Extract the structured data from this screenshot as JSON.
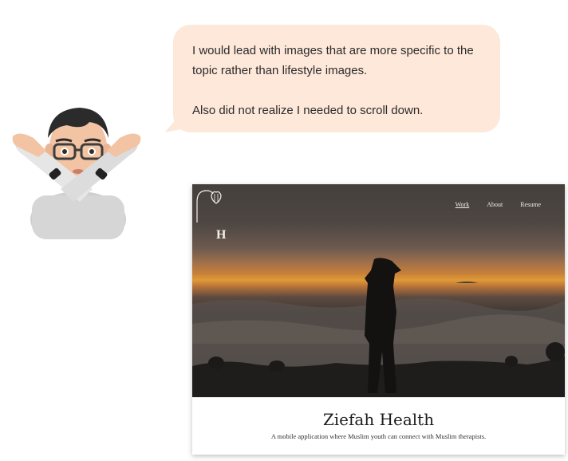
{
  "feedback": {
    "paragraph_1": "I would lead with images that are more specific to the topic rather than lifestyle images.",
    "paragraph_2": "Also did not realize I needed to scroll down."
  },
  "avatar": {
    "icon": "memoji-crossed-arms-icon"
  },
  "website": {
    "nav": {
      "work": "Work",
      "about": "About",
      "resume": "Resume",
      "active": "Work"
    },
    "logo_letter": "H",
    "title": "Ziefah Health",
    "subtitle": "A mobile application where Muslim youth can connect with Muslim therapists."
  },
  "colors": {
    "bubble": "#fde8da",
    "sunset_accent": "#e09a35"
  }
}
